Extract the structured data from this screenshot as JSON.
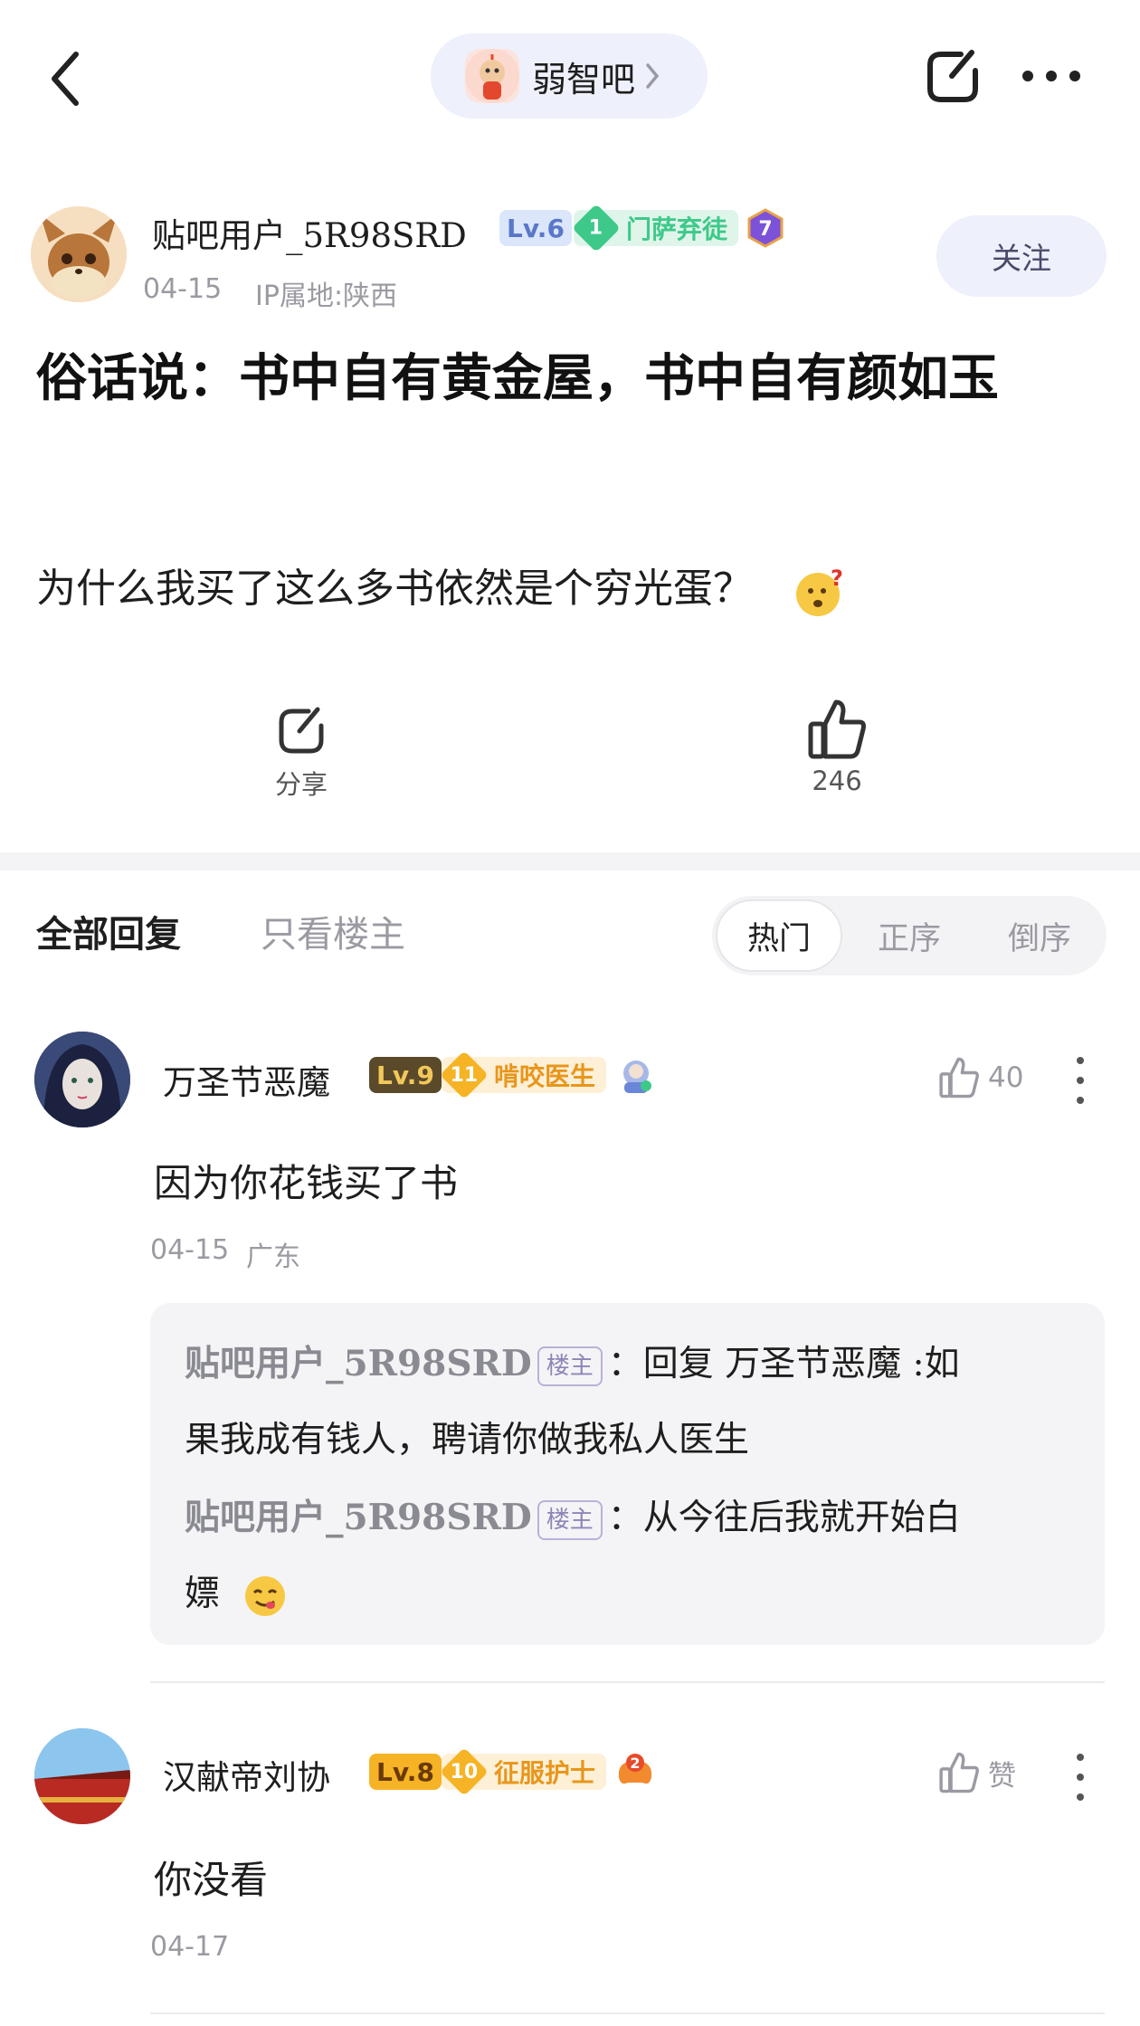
{
  "forum": {
    "name": "弱智吧"
  },
  "post": {
    "author": {
      "name": "贴吧用户_5R98SRD",
      "level": "Lv.6",
      "badge_num": "1",
      "badge_text": "门萨弃徒",
      "medal_num": "7"
    },
    "date": "04-15",
    "ip": "IP属地:陕西",
    "follow_label": "关注",
    "title": "俗话说：书中自有黄金屋，书中自有颜如玉",
    "body": "为什么我买了这么多书依然是个穷光蛋？",
    "share_label": "分享",
    "like_count": "246"
  },
  "tabs": {
    "all": "全部回复",
    "op_only": "只看楼主"
  },
  "sort": {
    "hot": "热门",
    "asc": "正序",
    "desc": "倒序"
  },
  "comments": [
    {
      "name": "万圣节恶魔",
      "level": "Lv.9",
      "badge_num": "11",
      "badge_text": "啃咬医生",
      "likes": "40",
      "text": "因为你花钱买了书",
      "date": "04-15",
      "location": "广东",
      "replies": [
        {
          "name": "贴吧用户_5R98SRD",
          "tag": "楼主",
          "text1": "：回复 万圣节恶魔 :如",
          "text2": "果我成有钱人，聘请你做我私人医生"
        },
        {
          "name": "贴吧用户_5R98SRD",
          "tag": "楼主",
          "text1": "：从今往后我就开始白",
          "text2": "嫖"
        }
      ]
    },
    {
      "name": "汉献帝刘协",
      "level": "Lv.8",
      "badge_num": "10",
      "badge_text": "征服护士",
      "medal_num": "2",
      "likes": "赞",
      "text": "你没看",
      "date": "04-17"
    }
  ],
  "colors": {
    "accent_bg": "#eef0fb",
    "green_badge": "#3ec98a",
    "gold_badge": "#f5b325",
    "level_blue": "#5a78c8",
    "level_gold": "#c8902c"
  }
}
